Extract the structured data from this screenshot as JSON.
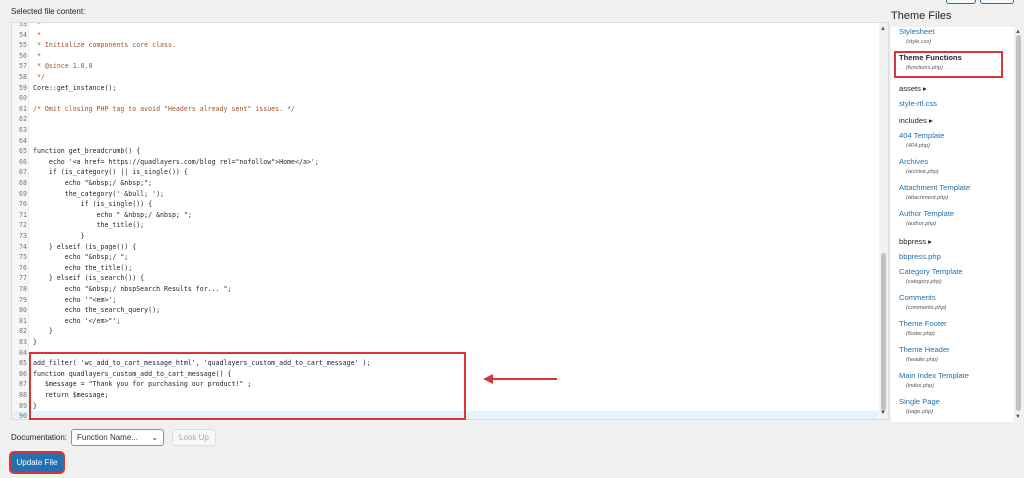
{
  "selected_label": "Selected file content:",
  "theme_files_title": "Theme Files",
  "code_lines": [
    {
      "n": "53",
      "text": " * ",
      "color": "#777777"
    },
    {
      "n": "54",
      "text": " *",
      "color": "#a0522d"
    },
    {
      "n": "55",
      "text": " * Initialize components core class.",
      "color": "#a0522d"
    },
    {
      "n": "56",
      "text": " *",
      "color": "#a0522d"
    },
    {
      "n": "57",
      "text": " * @since 1.0.0",
      "color": "#a0522d"
    },
    {
      "n": "58",
      "text": " */",
      "color": "#a0522d"
    },
    {
      "n": "59",
      "text": "Core::get_instance();",
      "color": "#1d2327"
    },
    {
      "n": "60",
      "text": "",
      "color": "#1d2327"
    },
    {
      "n": "61",
      "text": "/* Omit closing PHP tag to avoid \"Headers already sent\" issues. */",
      "color": "#a0522d"
    },
    {
      "n": "62",
      "text": "",
      "color": "#1d2327"
    },
    {
      "n": "63",
      "text": "",
      "color": "#1d2327"
    },
    {
      "n": "64",
      "text": "",
      "color": "#1d2327"
    },
    {
      "n": "65",
      "text": "function get_breadcrumb() {",
      "color": "#1d2327"
    },
    {
      "n": "66",
      "text": "    echo '<a href= https://quadlayers.com/blog rel=\"nofollow\">Home</a>';",
      "color": "#1d2327"
    },
    {
      "n": "67",
      "text": "    if (is_category() || is_single()) {",
      "color": "#1d2327"
    },
    {
      "n": "68",
      "text": "        echo \"&nbsp;/ &nbsp;\";",
      "color": "#1d2327"
    },
    {
      "n": "69",
      "text": "        the_category(' &bull; ');",
      "color": "#1d2327"
    },
    {
      "n": "70",
      "text": "            if (is_single()) {",
      "color": "#1d2327"
    },
    {
      "n": "71",
      "text": "                echo \" &nbsp;/ &nbsp; \";",
      "color": "#1d2327"
    },
    {
      "n": "72",
      "text": "                the_title();",
      "color": "#1d2327"
    },
    {
      "n": "73",
      "text": "            }",
      "color": "#1d2327"
    },
    {
      "n": "74",
      "text": "    } elseif (is_page()) {",
      "color": "#1d2327"
    },
    {
      "n": "75",
      "text": "        echo \"&nbsp;/ \";",
      "color": "#1d2327"
    },
    {
      "n": "76",
      "text": "        echo the_title();",
      "color": "#1d2327"
    },
    {
      "n": "77",
      "text": "    } elseif (is_search()) {",
      "color": "#1d2327"
    },
    {
      "n": "78",
      "text": "        echo \"&nbsp;/ nbspSearch Results for... \";",
      "color": "#1d2327"
    },
    {
      "n": "79",
      "text": "        echo '\"<em>';",
      "color": "#1d2327"
    },
    {
      "n": "80",
      "text": "        echo the_search_query();",
      "color": "#1d2327"
    },
    {
      "n": "81",
      "text": "        echo '</em>\"';",
      "color": "#1d2327"
    },
    {
      "n": "82",
      "text": "    }",
      "color": "#1d2327"
    },
    {
      "n": "83",
      "text": "}",
      "color": "#1d2327"
    },
    {
      "n": "84",
      "text": "",
      "color": "#1d2327"
    },
    {
      "n": "85",
      "text": "add_filter( 'wc_add_to_cart_message_html', 'quadlayers_custom_add_to_cart_message' );",
      "color": "#1d2327"
    },
    {
      "n": "86",
      "text": "function quadlayers_custom_add_to_cart_message() {",
      "color": "#1d2327"
    },
    {
      "n": "87",
      "text": "   $message = \"Thank you for purchasing our product!\" ;",
      "color": "#1d2327"
    },
    {
      "n": "88",
      "text": "   return $message;",
      "color": "#1d2327"
    },
    {
      "n": "89",
      "text": "}",
      "color": "#1d2327"
    },
    {
      "n": "90",
      "text": "",
      "color": "#1d2327"
    }
  ],
  "documentation": {
    "label": "Documentation:",
    "select_value": "Function Name...",
    "lookup_label": "Look Up"
  },
  "update_button": "Update File",
  "theme_files": [
    {
      "name": "Stylesheet",
      "sub": "(style.css)",
      "type": "file",
      "current": false
    },
    {
      "name": "Theme Functions",
      "sub": "(functions.php)",
      "type": "file",
      "current": true
    },
    {
      "name": "assets ▸",
      "sub": "",
      "type": "folder",
      "current": false
    },
    {
      "name": "style-rtl.css",
      "sub": "",
      "type": "file",
      "current": false
    },
    {
      "name": "includes ▸",
      "sub": "",
      "type": "folder",
      "current": false
    },
    {
      "name": "404 Template",
      "sub": "(404.php)",
      "type": "file",
      "current": false
    },
    {
      "name": "Archives",
      "sub": "(archive.php)",
      "type": "file",
      "current": false
    },
    {
      "name": "Attachment Template",
      "sub": "(attachment.php)",
      "type": "file",
      "current": false
    },
    {
      "name": "Author Template",
      "sub": "(author.php)",
      "type": "file",
      "current": false
    },
    {
      "name": "bbpress ▸",
      "sub": "",
      "type": "folder",
      "current": false
    },
    {
      "name": "bbpress.php",
      "sub": "",
      "type": "file",
      "current": false
    },
    {
      "name": "Category Template",
      "sub": "(category.php)",
      "type": "file",
      "current": false
    },
    {
      "name": "Comments",
      "sub": "(comments.php)",
      "type": "file",
      "current": false
    },
    {
      "name": "Theme Footer",
      "sub": "(footer.php)",
      "type": "file",
      "current": false
    },
    {
      "name": "Theme Header",
      "sub": "(header.php)",
      "type": "file",
      "current": false
    },
    {
      "name": "Main Index Template",
      "sub": "(index.php)",
      "type": "file",
      "current": false
    },
    {
      "name": "Single Page",
      "sub": "(page.php)",
      "type": "file",
      "current": false
    }
  ],
  "colors": {
    "accent": "#2271b1",
    "highlight": "#d63638",
    "keyword": "#0000ff"
  }
}
